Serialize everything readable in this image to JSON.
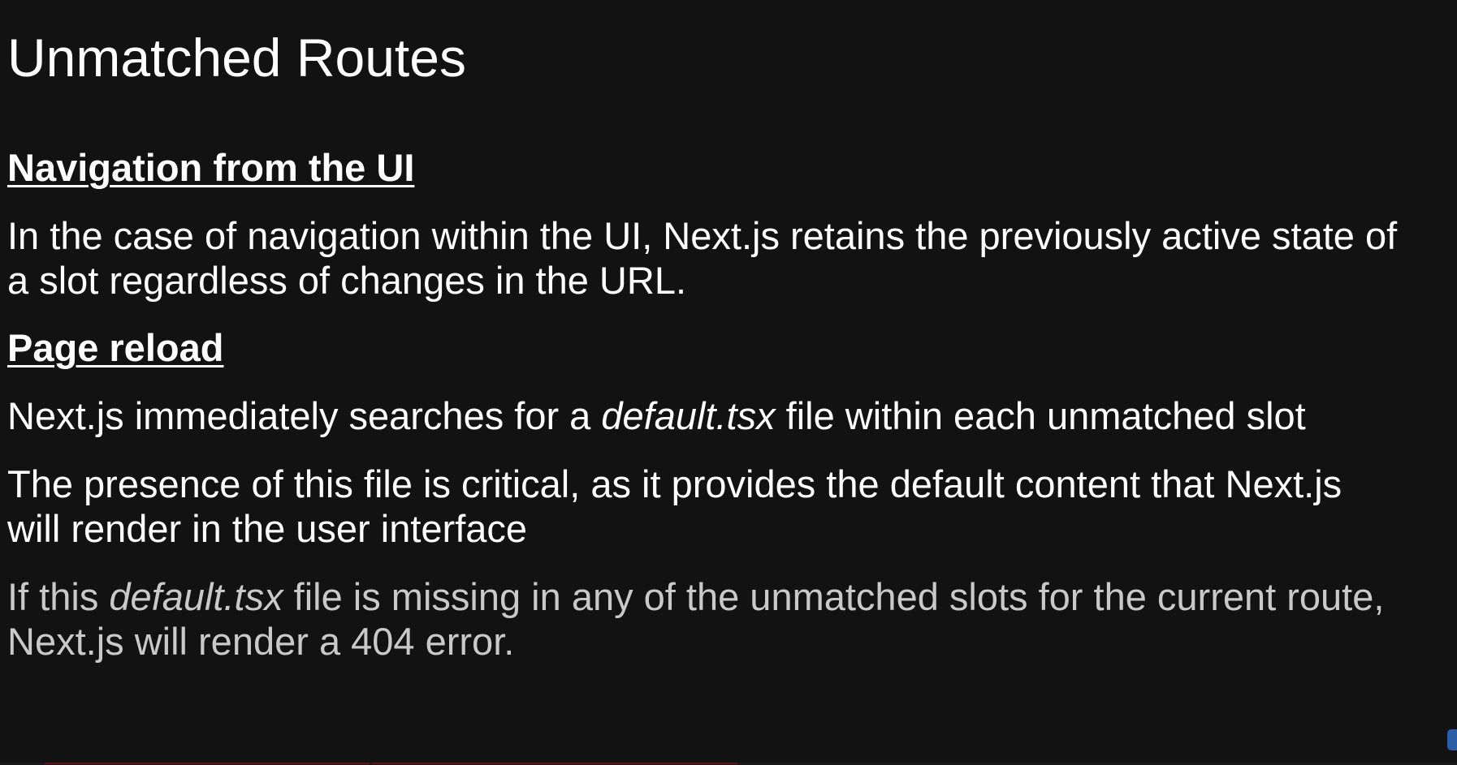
{
  "slide": {
    "title": "Unmatched Routes",
    "sections": [
      {
        "heading": "Navigation from the UI",
        "paragraphs": [
          {
            "text_line1": "In the case of navigation within the UI, Next.js retains the previously active state of",
            "text_line2": "a slot regardless of changes in the URL."
          }
        ]
      },
      {
        "heading": "Page reload",
        "paragraphs": [
          {
            "before": "Next.js immediately searches for a ",
            "file": "default.tsx",
            "after": " file within each unmatched slot"
          },
          {
            "text_line1": "The presence of this file is critical, as it provides the default content that Next.js",
            "text_line2": "will render in the user interface"
          },
          {
            "before": "If this ",
            "file": "default.tsx",
            "after_line1": " file is missing in any of the unmatched slots for the current route,",
            "text_line2": "Next.js will render a 404 error."
          }
        ]
      }
    ]
  },
  "colors": {
    "background": "#121212",
    "text": "#ffffff",
    "dimmed_text": "#c9c9c9"
  }
}
